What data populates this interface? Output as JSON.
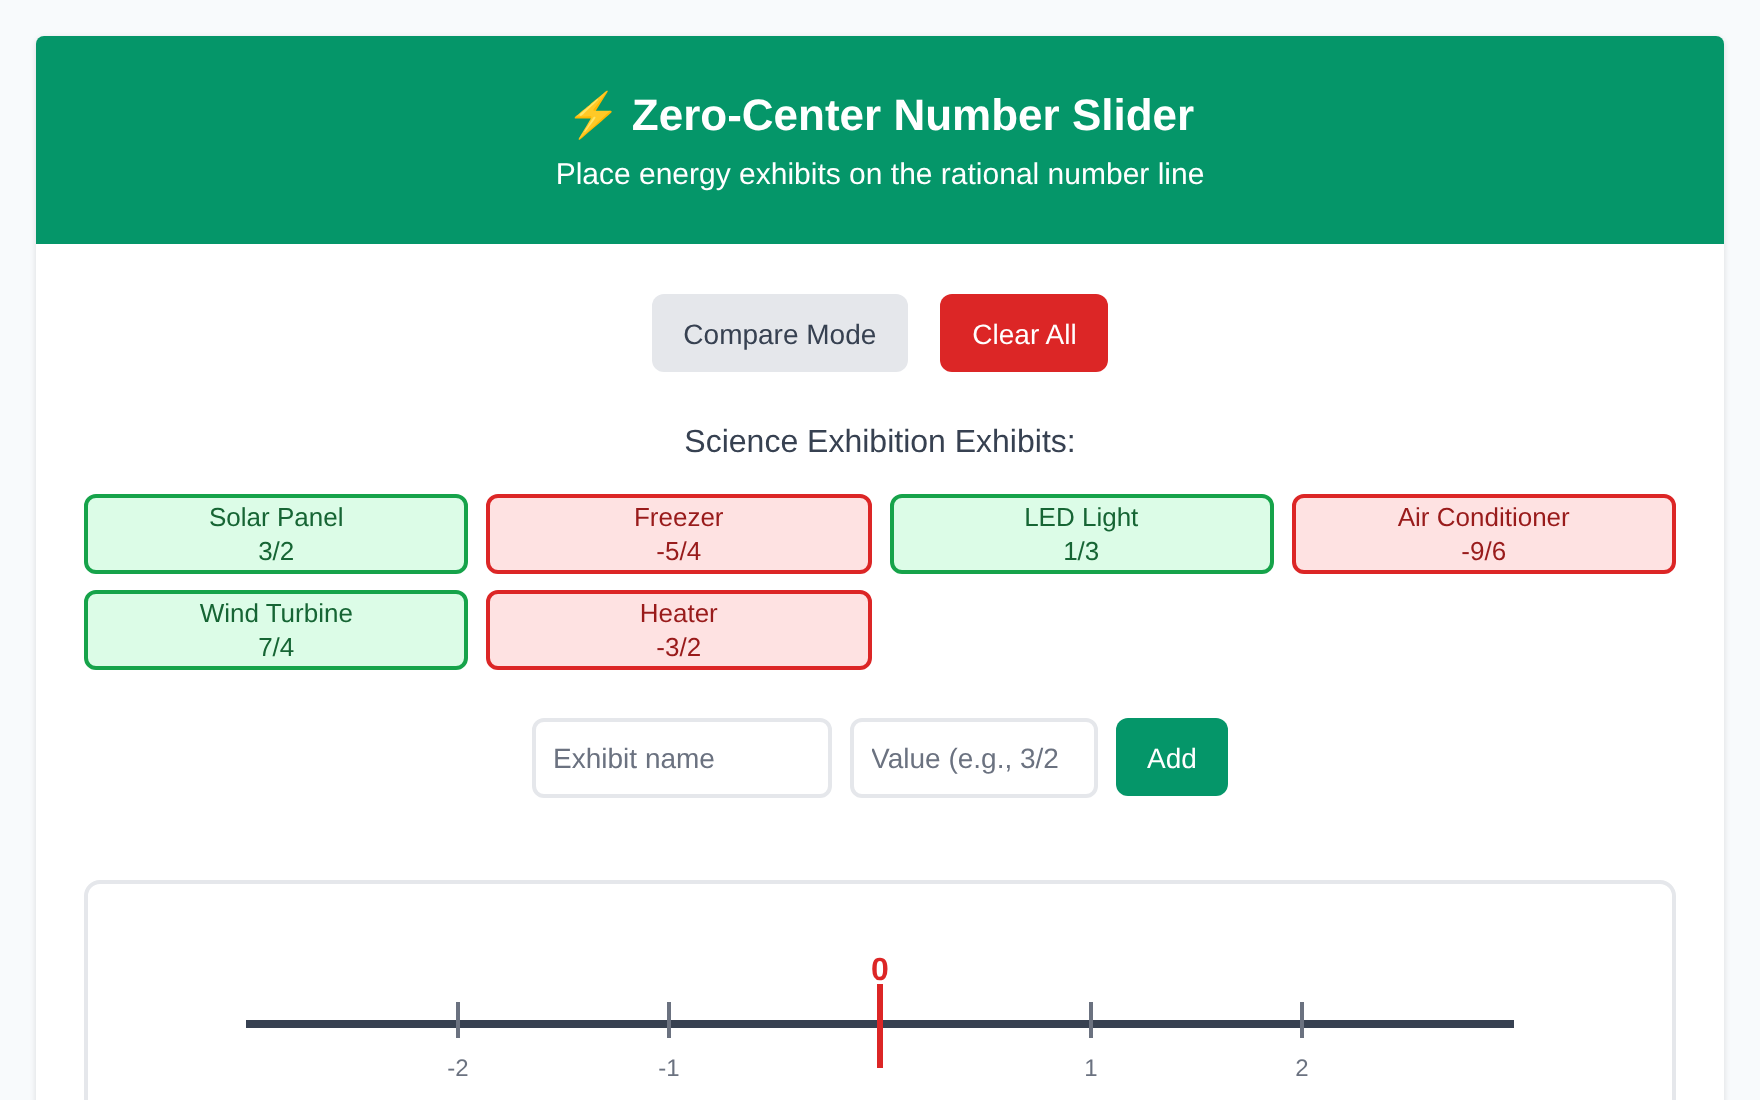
{
  "header": {
    "icon": "⚡",
    "title": "Zero-Center Number Slider",
    "subtitle": "Place energy exhibits on the rational number line"
  },
  "buttons": [
    {
      "label": "Compare Mode",
      "kind": "secondary"
    },
    {
      "label": "Clear All",
      "kind": "danger"
    }
  ],
  "exhibits_heading": "Science Exhibition Exhibits:",
  "exhibits": [
    {
      "name": "Solar Panel",
      "value": "3/2",
      "kind": "positive"
    },
    {
      "name": "Freezer",
      "value": "-5/4",
      "kind": "negative"
    },
    {
      "name": "LED Light",
      "value": "1/3",
      "kind": "positive"
    },
    {
      "name": "Air Conditioner",
      "value": "-9/6",
      "kind": "negative"
    },
    {
      "name": "Wind Turbine",
      "value": "7/4",
      "kind": "positive"
    },
    {
      "name": "Heater",
      "value": "-3/2",
      "kind": "negative"
    }
  ],
  "add_form": {
    "name_placeholder": "Exhibit name",
    "value_placeholder": "Value (e.g., 3/2",
    "button": "Add"
  },
  "number_line": {
    "zero_label": "0",
    "negative_ticks": [
      "-2",
      "-1"
    ],
    "positive_ticks": [
      "1",
      "2"
    ]
  }
}
